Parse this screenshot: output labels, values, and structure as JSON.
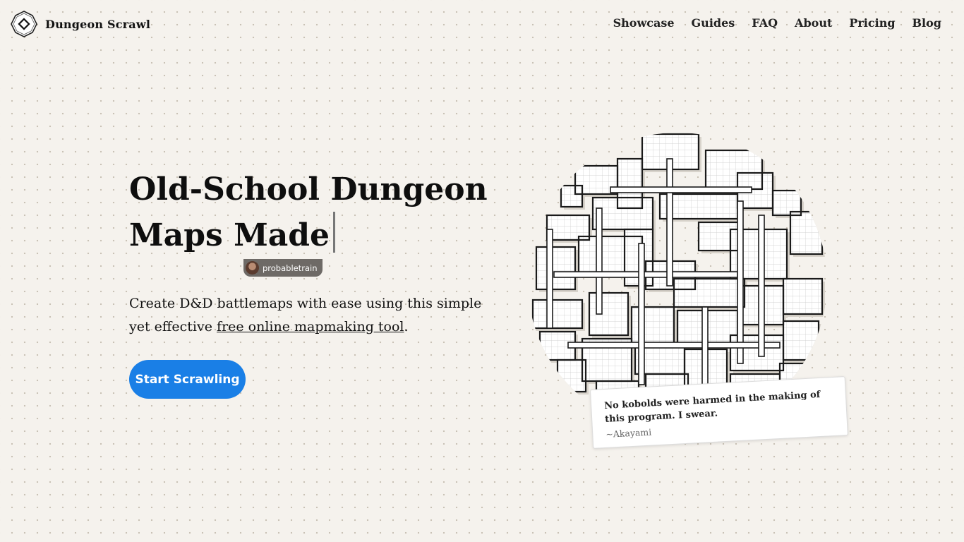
{
  "brand": {
    "name": "Dungeon Scrawl",
    "logo_icon": "diamond-logo-icon"
  },
  "nav": {
    "items": [
      "Showcase",
      "Guides",
      "FAQ",
      "About",
      "Pricing",
      "Blog"
    ]
  },
  "hero": {
    "title_line1": "Old-School Dungeon",
    "title_line2": "Maps Made",
    "presence_user": "probabletrain",
    "description_prefix": "Create D&D battlemaps with ease using this simple yet effective",
    "description_link": "free online mapmaking tool",
    "description_suffix": ".",
    "cta_label": "Start Scrawling"
  },
  "quote": {
    "text": "No kobolds were harmed in the making of this program. I swear.",
    "author": "~Akayami"
  },
  "colors": {
    "background": "#f5f2ed",
    "accent": "#1a7fe6",
    "ink": "#111111"
  }
}
